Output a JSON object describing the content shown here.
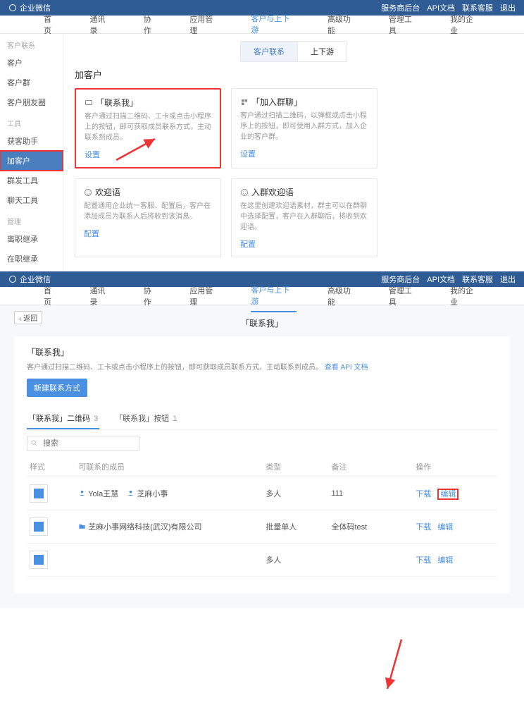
{
  "topbar": {
    "app_name": "企业微信",
    "right_links": [
      "服务商后台",
      "API文档",
      "联系客服",
      "退出"
    ]
  },
  "nav": {
    "items": [
      "首页",
      "通讯录",
      "协作",
      "应用管理",
      "客户与上下游",
      "高级功能",
      "管理工具",
      "我的企业"
    ],
    "active_index": 4
  },
  "s1": {
    "sidebar": {
      "groups": [
        {
          "title": "客户联系",
          "items": [
            "客户",
            "客户群",
            "客户朋友圈"
          ]
        },
        {
          "title": "工具",
          "items": [
            "获客助手",
            "加客户",
            "群发工具",
            "聊天工具"
          ]
        },
        {
          "title": "管理",
          "items": [
            "离职继承",
            "在职继承"
          ]
        }
      ],
      "active_label": "加客户"
    },
    "subtabs": {
      "items": [
        "客户联系",
        "上下游"
      ],
      "active_index": 0
    },
    "section_title": "加客户",
    "cards": [
      {
        "title": "「联系我」",
        "desc": "客户通过扫描二维码、工卡或点击小程序上的按钮，即可获取成员联系方式，主动联系到成员。",
        "action": "设置",
        "highlighted": true
      },
      {
        "title": "「加入群聊」",
        "desc": "客户通过扫描二维码，以弹框或点击小程序上的按钮，即可使用入群方式，加入企业的客户群。",
        "action": "设置"
      },
      {
        "title": "欢迎语",
        "desc": "配置通用企业统一客服、配置后，客户在添加成员为联系人后将收到该消息。",
        "action": "配置",
        "icon": "smile"
      },
      {
        "title": "入群欢迎语",
        "desc": "在这里创建欢迎语素材，群主可以在群聊中选择配置，客户在入群聊后，将收到欢迎语。",
        "action": "配置",
        "icon": "smile"
      }
    ]
  },
  "s2": {
    "back_label": "返回",
    "page_title": "「联系我」",
    "subtitle": "「联系我」",
    "desc_prefix": "客户通过扫描二维码、工卡或点击小程序上的按钮，即可获取成员联系方式，主动联系到成员。",
    "desc_link": "查看 API 文档",
    "new_btn": "新建联系方式",
    "tabs": [
      {
        "label": "「联系我」二维码",
        "count": 3,
        "active": true
      },
      {
        "label": "「联系我」按钮",
        "count": 1
      }
    ],
    "search": {
      "placeholder": "搜索"
    },
    "table": {
      "headers": [
        "样式",
        "可联系的成员",
        "类型",
        "备注",
        "操作"
      ],
      "rows": [
        {
          "members": [
            {
              "kind": "user",
              "text": "Yola王慧"
            },
            {
              "kind": "user",
              "text": "芝麻小事"
            }
          ],
          "type": "多人",
          "remark": "111",
          "ops": [
            "下载",
            "编辑"
          ],
          "op_highlight_index": 1
        },
        {
          "members": [
            {
              "kind": "dept",
              "text": "芝麻小事网络科技(武汉)有限公司"
            }
          ],
          "type": "批量单人",
          "remark": "全体码test",
          "ops": [
            "下载",
            "编辑"
          ]
        },
        {
          "members": [],
          "type": "多人",
          "remark": "",
          "ops": [
            "下载",
            "编辑"
          ]
        }
      ]
    }
  }
}
